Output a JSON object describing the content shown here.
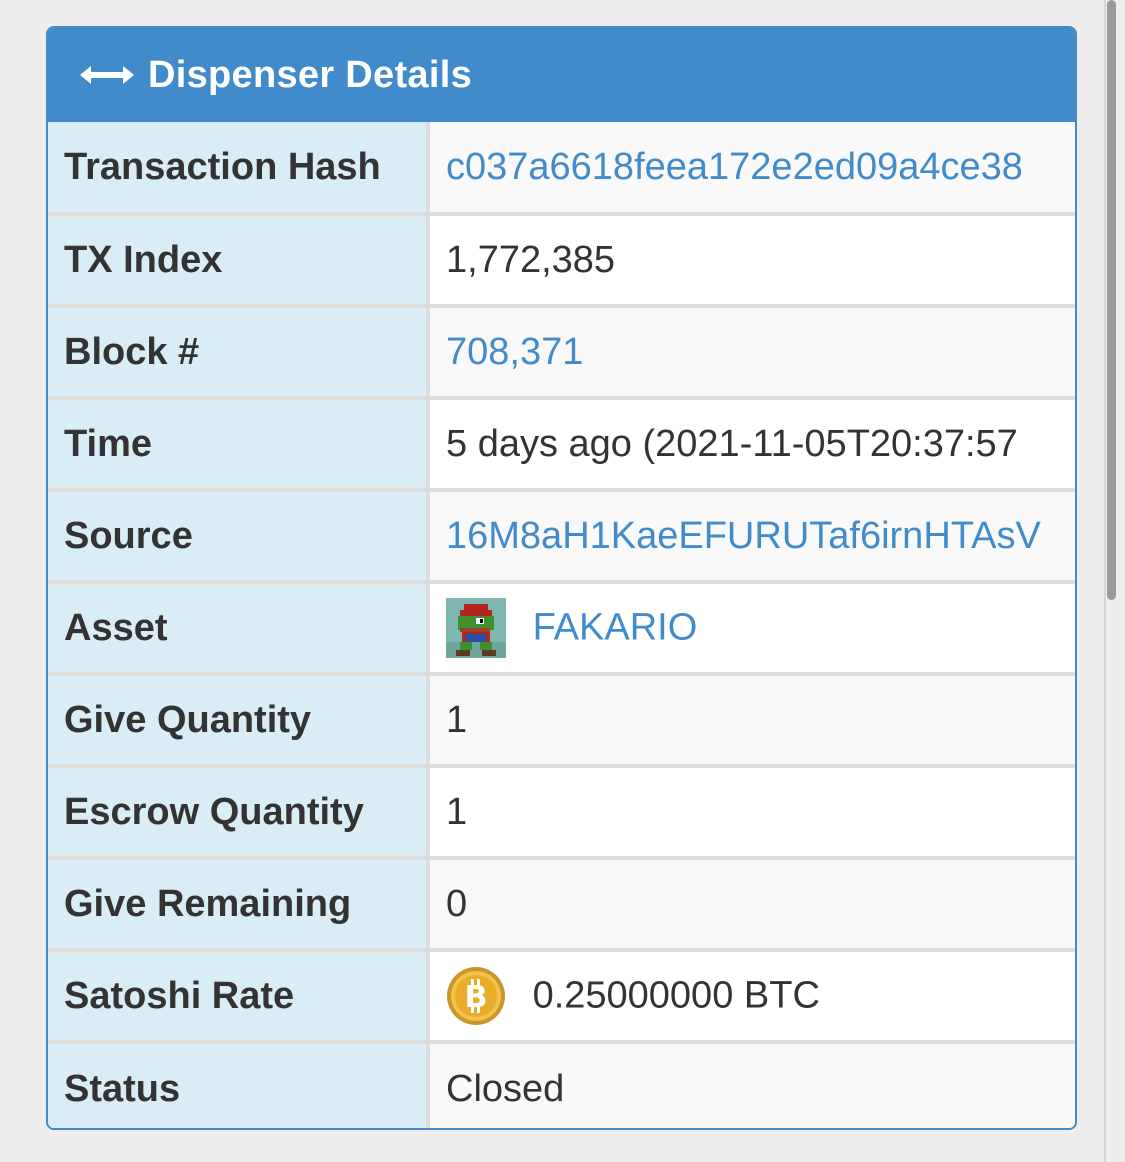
{
  "panel": {
    "title": "Dispenser Details",
    "title_icon": "horizontal-double-arrow-icon"
  },
  "rows": [
    {
      "label": "Transaction Hash",
      "value": "c037a6618feea172e2ed09a4ce38",
      "link": true
    },
    {
      "label": "TX Index",
      "value": "1,772,385",
      "link": false
    },
    {
      "label": "Block #",
      "value": "708,371",
      "link": true
    },
    {
      "label": "Time",
      "value": "5 days ago (2021-11-05T20:37:57",
      "link": false
    },
    {
      "label": "Source",
      "value": "16M8aH1KaeEFURUTaf6irnHTAsV",
      "link": true
    },
    {
      "label": "Asset",
      "value": "FAKARIO",
      "link": true,
      "icon": "asset-thumbnail"
    },
    {
      "label": "Give Quantity",
      "value": "1",
      "link": false
    },
    {
      "label": "Escrow Quantity",
      "value": "1",
      "link": false
    },
    {
      "label": "Give Remaining",
      "value": "0",
      "link": false
    },
    {
      "label": "Satoshi Rate",
      "value": "0.25000000 BTC",
      "link": false,
      "icon": "bitcoin-icon"
    },
    {
      "label": "Status",
      "value": "Closed",
      "link": false
    }
  ],
  "colors": {
    "primary": "#428bca",
    "label_bg": "#d9edf7",
    "text": "#333333"
  }
}
